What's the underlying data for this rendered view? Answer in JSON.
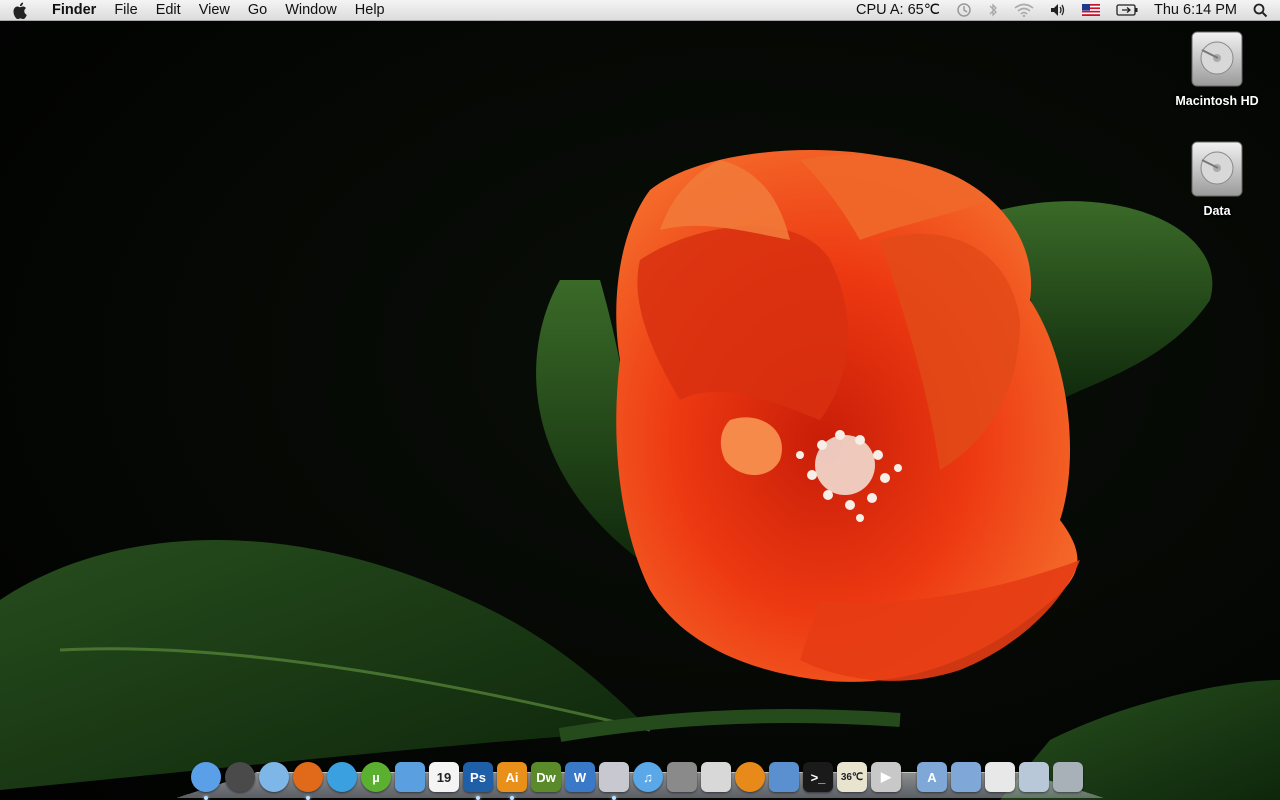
{
  "menubar": {
    "apple_icon": "apple-icon",
    "app_name": "Finder",
    "menus": [
      "File",
      "Edit",
      "View",
      "Go",
      "Window",
      "Help"
    ],
    "cpu_label": "CPU A: 65℃",
    "status_icons": [
      "time-machine-icon",
      "bluetooth-icon",
      "wifi-icon",
      "volume-icon",
      "us-flag-icon",
      "battery-icon"
    ],
    "clock": "Thu 6:14 PM",
    "spotlight_icon": "spotlight-search-icon"
  },
  "desktop": {
    "icons": [
      {
        "label": "Macintosh HD",
        "icon": "hard-drive-icon"
      },
      {
        "label": "Data",
        "icon": "hard-drive-icon"
      }
    ]
  },
  "dock": {
    "items": [
      {
        "name": "finder",
        "text": "",
        "color": "#5aa0e8"
      },
      {
        "name": "dashboard",
        "text": "",
        "color": "#4a4a4a"
      },
      {
        "name": "safari",
        "text": "",
        "color": "#7fb6e8"
      },
      {
        "name": "firefox",
        "text": "",
        "color": "#e06a1a"
      },
      {
        "name": "media-forward",
        "text": "",
        "color": "#3aa0e0"
      },
      {
        "name": "utorrent",
        "text": "µ",
        "color": "#5cb030"
      },
      {
        "name": "messenger",
        "text": "",
        "color": "#5aa0e0"
      },
      {
        "name": "ical",
        "text": "19",
        "color": "#f4f4f4"
      },
      {
        "name": "photoshop",
        "text": "Ps",
        "color": "#1e5fa8"
      },
      {
        "name": "illustrator",
        "text": "Ai",
        "color": "#e8901a"
      },
      {
        "name": "dreamweaver",
        "text": "Dw",
        "color": "#5a8a2a"
      },
      {
        "name": "word",
        "text": "W",
        "color": "#3a78c8"
      },
      {
        "name": "preview",
        "text": "",
        "color": "#c8c8d0"
      },
      {
        "name": "itunes",
        "text": "♫",
        "color": "#5aa8e8"
      },
      {
        "name": "system-preferences",
        "text": "",
        "color": "#8a8a8a"
      },
      {
        "name": "cyberduck",
        "text": "",
        "color": "#d8d8d8"
      },
      {
        "name": "vlc",
        "text": "",
        "color": "#e88a1a"
      },
      {
        "name": "xcode",
        "text": "",
        "color": "#5a90d0"
      },
      {
        "name": "terminal",
        "text": ">_",
        "color": "#1a1a1a"
      },
      {
        "name": "temperature-monitor",
        "text": "36℃",
        "color": "#e8e4d0"
      },
      {
        "name": "quicktime",
        "text": "▶",
        "color": "#c8c8c8"
      },
      {
        "name": "applications-folder",
        "text": "A",
        "color": "#7fa8d8"
      },
      {
        "name": "documents-folder",
        "text": "",
        "color": "#7fa8d8"
      },
      {
        "name": "zip-archive",
        "text": "",
        "color": "#e8e8e8"
      },
      {
        "name": "disk-image",
        "text": "",
        "color": "#b8c8d8"
      },
      {
        "name": "trash",
        "text": "",
        "color": "#a8b0b8"
      }
    ],
    "running": [
      "finder",
      "firefox",
      "photoshop",
      "illustrator",
      "preview"
    ]
  }
}
